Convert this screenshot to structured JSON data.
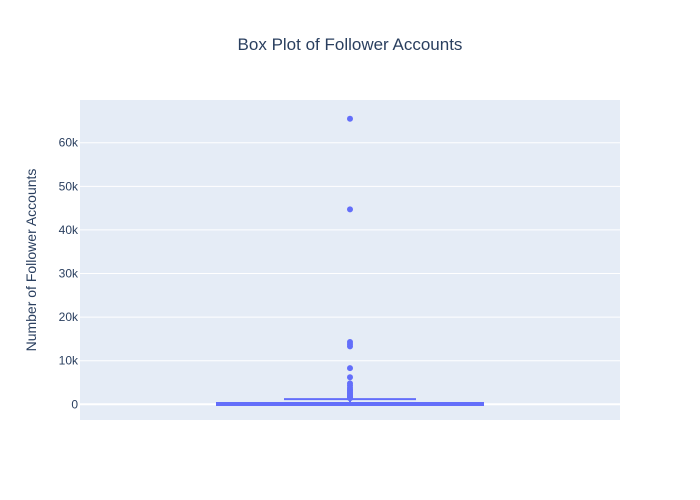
{
  "chart_data": {
    "type": "box",
    "title": "Box Plot of Follower Accounts",
    "xlabel": "",
    "ylabel": "Number of Follower Accounts",
    "ylim": [
      -3600,
      69800
    ],
    "y_ticks": [
      0,
      10000,
      20000,
      30000,
      40000,
      50000,
      60000
    ],
    "y_tick_labels": [
      "0",
      "10k",
      "20k",
      "30k",
      "40k",
      "50k",
      "60k"
    ],
    "grid": true,
    "legend": "none",
    "box": {
      "min": 0,
      "q1": 10,
      "median": 60,
      "q3": 300,
      "upper_fence": 1200
    },
    "outliers": [
      1400,
      1600,
      1800,
      2000,
      2200,
      2500,
      2800,
      3100,
      3400,
      3800,
      4300,
      4800,
      6200,
      8300,
      13300,
      13800,
      14300,
      44700,
      65500
    ],
    "colors": {
      "series": "#636efa",
      "plot_bg": "#e5ecf6",
      "grid": "#ffffff",
      "text": "#2a3f5f"
    }
  }
}
